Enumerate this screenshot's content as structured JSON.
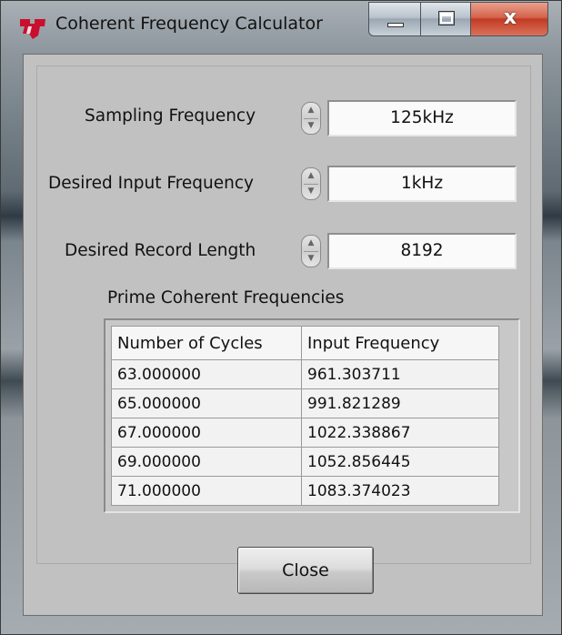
{
  "window": {
    "title": "Coherent Frequency Calculator",
    "icon": "ti-logo-icon",
    "controls": {
      "minimize": "minimize-icon",
      "maximize": "maximize-icon",
      "close_glyph": "x"
    }
  },
  "fields": {
    "sampling": {
      "label": "Sampling Frequency",
      "value": "125kHz"
    },
    "input_freq": {
      "label": "Desired Input Frequency",
      "value": "1kHz"
    },
    "record_length": {
      "label": "Desired Record Length",
      "value": "8192"
    }
  },
  "results": {
    "title": "Prime Coherent Frequencies",
    "columns": [
      "Number of Cycles",
      "Input Frequency"
    ],
    "rows": [
      [
        "63.000000",
        "961.303711"
      ],
      [
        "65.000000",
        "991.821289"
      ],
      [
        "67.000000",
        "1022.338867"
      ],
      [
        "69.000000",
        "1052.856445"
      ],
      [
        "71.000000",
        "1083.374023"
      ]
    ]
  },
  "buttons": {
    "close_label": "Close"
  },
  "colors": {
    "client_bg": "#c1c1c1",
    "close_caption": "#c33a22",
    "logo": "#c8102e"
  }
}
